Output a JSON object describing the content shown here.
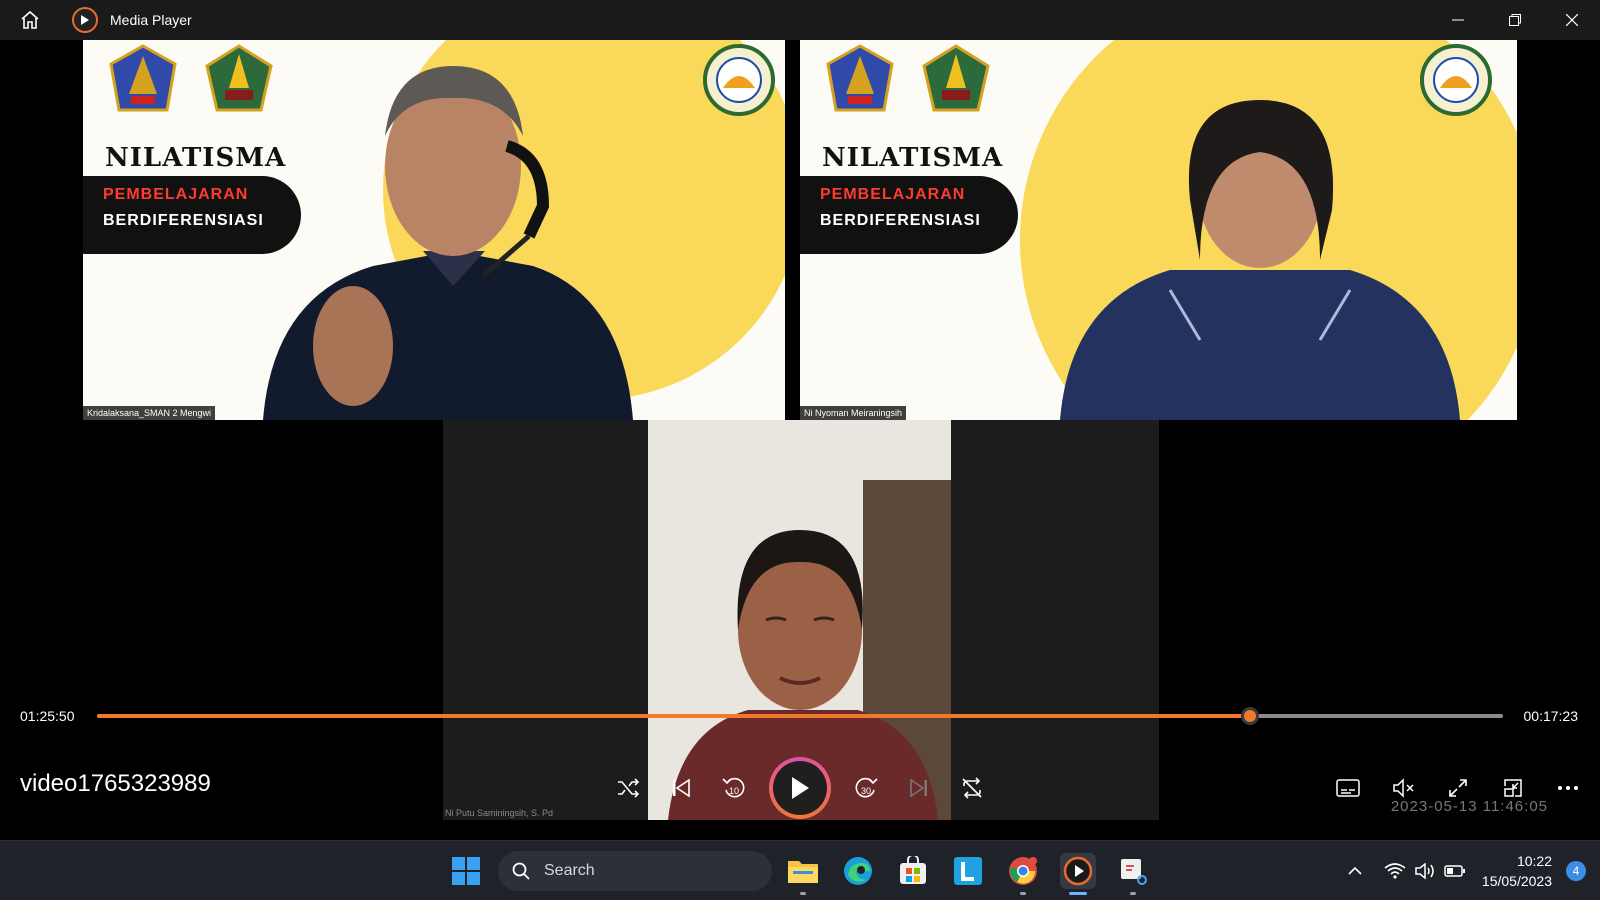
{
  "window": {
    "title": "Media Player",
    "icons": {
      "home": "home-icon",
      "app": "media-player-icon",
      "minimize": "minimize-icon",
      "maximize": "restore-icon",
      "close": "close-icon"
    }
  },
  "video": {
    "tiles": [
      {
        "brand": "NILATISMA",
        "pill_red": "PEMBELAJARAN",
        "pill_white": "BERDIFERENSIASI",
        "participant": "Kridalaksana_SMAN 2 Mengwi"
      },
      {
        "brand": "NILATISMA",
        "pill_red": "PEMBELAJARAN",
        "pill_white": "BERDIFERENSIASI",
        "participant": "Ni Nyoman Meiraningsih"
      }
    ],
    "bottom_participant": "Ni Putu Saminingsih, S. Pd",
    "burned_timestamp": "2023-05-13 11:46:05"
  },
  "player": {
    "elapsed": "01:25:50",
    "remaining": "00:17:23",
    "progress": 0.82,
    "media_title": "video1765323989",
    "accent_color": "#f07a2c",
    "transport": [
      "shuffle-icon",
      "previous-icon",
      "rewind-10-icon",
      "play-icon",
      "forward-30-icon",
      "next-icon",
      "repeat-off-icon"
    ],
    "extras": [
      "subtitles-icon",
      "mute-icon",
      "fullscreen-icon",
      "mini-player-icon",
      "more-icon"
    ]
  },
  "taskbar": {
    "search_placeholder": "Search",
    "apps": [
      "file-explorer-icon",
      "edge-icon",
      "store-icon",
      "l-app-icon",
      "chrome-icon",
      "media-player-icon",
      "snipping-tool-icon"
    ],
    "time": "10:22",
    "date": "15/05/2023",
    "notification_count": "4"
  }
}
